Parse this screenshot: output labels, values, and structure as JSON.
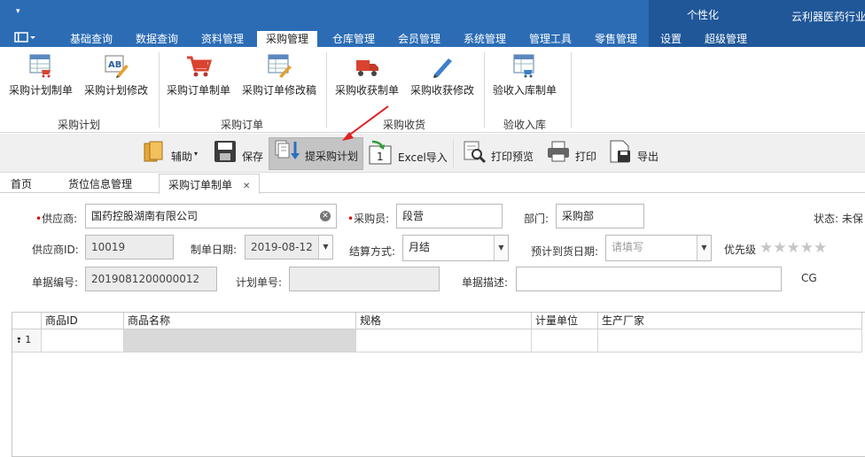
{
  "titlebar": {
    "quick_access": "▾",
    "personal": "个性化",
    "brand": "云利器医药行业"
  },
  "menu_tabs": [
    "基础查询",
    "数据查询",
    "资料管理",
    "采购管理",
    "仓库管理",
    "会员管理",
    "系统管理",
    "管理工具",
    "零售管理",
    "设置",
    "超级管理"
  ],
  "active_tab": "采购管理",
  "ribbon": {
    "buttons": [
      "采购计划制单",
      "采购计划修改",
      "采购订单制单",
      "采购订单修改稿",
      "采购收获制单",
      "采购收获修改",
      "验收入库制单"
    ],
    "groups": [
      "采购计划",
      "采购订单",
      "采购收货",
      "验收入库"
    ]
  },
  "toolbar": {
    "assist": "辅助",
    "save": "保存",
    "extract_plan": "提采购计划",
    "excel_import": "Excel导入",
    "print_preview": "打印预览",
    "print": "打印",
    "export": "导出"
  },
  "doc_tabs": {
    "home": "首页",
    "location": "货位信息管理",
    "active": "采购订单制单",
    "close": "✕"
  },
  "form": {
    "supplier_label": "供应商:",
    "supplier": "国药控股湖南有限公司",
    "buyer_label": "采购员:",
    "buyer": "段营",
    "dept_label": "部门:",
    "dept": "采购部",
    "status_label": "状态: 未保",
    "supplier_id_label": "供应商ID:",
    "supplier_id": "10019",
    "date_label": "制单日期:",
    "date": "2019-08-12",
    "settle_label": "结算方式:",
    "settle": "月结",
    "arrival_label": "预计到货日期:",
    "arrival_placeholder": "请填写",
    "priority_label": "优先级",
    "priority_stars": "★★★★★",
    "docno_label": "单据编号:",
    "docno": "2019081200000012",
    "planno_label": "计划单号:",
    "planno": "",
    "desc_label": "单据描述:",
    "desc": "",
    "cg": "CG"
  },
  "grid": {
    "columns": [
      "商品ID",
      "商品名称",
      "规格",
      "计量单位",
      "生产厂家"
    ],
    "row_number": "1"
  },
  "colors": {
    "titlebar": "#2b6cb5",
    "titlebar_dark": "#1f5799",
    "annotation_arrow": "#e02020"
  }
}
